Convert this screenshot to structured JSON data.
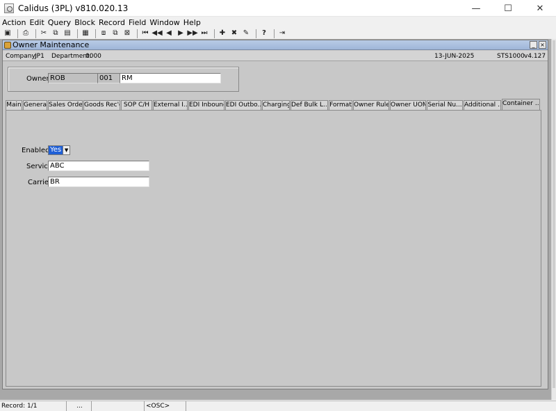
{
  "app": {
    "title": "Calidus (3PL) v810.020.13"
  },
  "window_controls": {
    "minimize": "—",
    "maximize": "☐",
    "close": "✕"
  },
  "menu": [
    "Action",
    "Edit",
    "Query",
    "Block",
    "Record",
    "Field",
    "Window",
    "Help"
  ],
  "toolbar": {
    "icons": [
      "save-icon",
      "print-icon",
      "cut-icon",
      "copy-icon",
      "paste-icon",
      "clear-icon",
      "duplicate-icon",
      "copy-record-icon",
      "clear-record-icon",
      "first-record-icon",
      "previous-set-icon",
      "previous-record-icon",
      "next-record-icon",
      "next-set-icon",
      "last-record-icon",
      "insert-record-icon",
      "delete-record-icon",
      "lock-record-icon",
      "help-icon",
      "exit-icon"
    ],
    "glyphs": {
      "save": "▣",
      "print": "⎙",
      "cut": "✂",
      "copy": "⧉",
      "paste": "▤",
      "clear": "▦",
      "duplicate": "⧈",
      "copy_record": "⧉",
      "clear_record": "⊠",
      "first": "⏮",
      "prev_set": "◀◀",
      "prev": "◀",
      "next": "▶",
      "next_set": "▶▶",
      "last": "⏭",
      "insert": "✚",
      "delete": "✖",
      "lock": "✎",
      "help": "?",
      "exit": "⇥"
    }
  },
  "form": {
    "title": "Owner Maintenance",
    "controls": {
      "minimize": "_",
      "close": "×"
    },
    "company_label": "Company:",
    "company_value": "JP1",
    "department_label": "Department:",
    "department_value": "0000",
    "date": "13-JUN-2025",
    "module": "STS1000",
    "version": "v4.127",
    "owner": {
      "label": "Owner",
      "code": "ROB",
      "number": "001",
      "name": "RM"
    },
    "tabs": [
      "Main",
      "General",
      "Sales Order",
      "Goods Rec'd",
      "SOP C/H",
      "External I...",
      "EDI Inbound",
      "EDI Outbo...",
      "Charging",
      "Def Bulk L...",
      "Format",
      "Owner Rules",
      "Owner UOM",
      "Serial Nu...",
      "Additional ...",
      "Container ..."
    ],
    "active_tab": "Container ...",
    "container": {
      "enabled_label": "Enabled",
      "enabled_value": "Yes",
      "service_label": "Service",
      "service_value": "ABC",
      "carrier_label": "Carrier",
      "carrier_value": "BR"
    }
  },
  "status": {
    "record": "Record: 1/1",
    "ellipsis": "...",
    "osc": "<OSC>"
  }
}
